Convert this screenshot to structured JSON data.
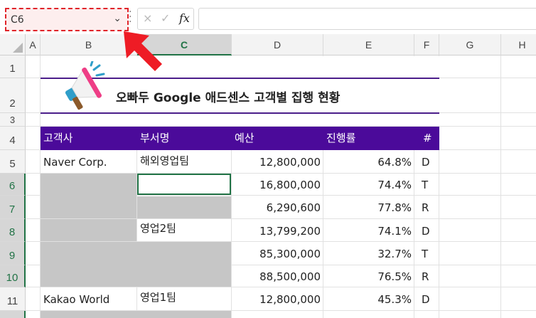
{
  "formula_bar": {
    "name_box": "C6",
    "cancel_icon": "×",
    "enter_icon": "✓",
    "fx_label": "fx",
    "formula": ""
  },
  "columns": [
    "A",
    "B",
    "C",
    "D",
    "E",
    "F",
    "G",
    "H"
  ],
  "rows": [
    "1",
    "2",
    "3",
    "4",
    "5",
    "6",
    "7",
    "8",
    "9",
    "10",
    "11"
  ],
  "selected_cell": {
    "column": "C",
    "row": "6"
  },
  "title": "오빠두 Google 애드센스 고객별 집행 현황",
  "table": {
    "headers": [
      "고객사",
      "부서명",
      "예산",
      "진행률",
      "#"
    ],
    "rows": [
      {
        "client": "Naver Corp.",
        "dept": "해외영업팀",
        "budget": "12,800,000",
        "progress": "64.8%",
        "flag": "D"
      },
      {
        "client": "",
        "dept": "",
        "budget": "16,800,000",
        "progress": "74.4%",
        "flag": "T"
      },
      {
        "client": "",
        "dept": "",
        "budget": "6,290,600",
        "progress": "77.8%",
        "flag": "R"
      },
      {
        "client": "",
        "dept": "영업2팀",
        "budget": "13,799,200",
        "progress": "74.1%",
        "flag": "D"
      },
      {
        "client": "",
        "dept": "",
        "budget": "85,300,000",
        "progress": "32.7%",
        "flag": "T"
      },
      {
        "client": "",
        "dept": "",
        "budget": "88,500,000",
        "progress": "76.5%",
        "flag": "R"
      },
      {
        "client": "Kakao World",
        "dept": "영업1팀",
        "budget": "12,800,000",
        "progress": "45.3%",
        "flag": "D"
      }
    ]
  },
  "colors": {
    "header_band": "#4b0a9a",
    "highlight": "#e0242a",
    "selection": "#217346",
    "blank_cells": "#c6c6c6"
  },
  "icons": [
    "megaphone-icon",
    "red-arrow-icon"
  ]
}
